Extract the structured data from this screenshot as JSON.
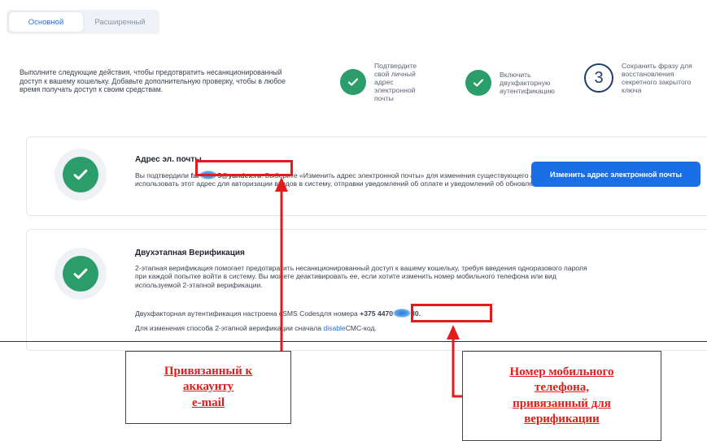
{
  "tabs": [
    {
      "label": "Основной",
      "active": true
    },
    {
      "label": "Расширенный",
      "active": false
    }
  ],
  "intro": "Выполните следующие действия, чтобы предотвратить несанкционированный доступ к вашему кошельку. Добавьте дополнительную проверку, чтобы в любое время получать доступ к своим средствам.",
  "steps": [
    {
      "label": "Подтвердите свой личный адрес электронной почты",
      "done": true
    },
    {
      "label": "Включить двухфакторную аутентификацию",
      "done": true
    },
    {
      "label": "Сохранить фразу для восстановления секретного закрытого ключа",
      "done": false,
      "number": "3"
    }
  ],
  "email_card": {
    "title": "Адрес эл. почты",
    "text_before": "Вы подтвердили ",
    "email_start": "far",
    "email_end": "5@yandex.ru",
    "text_after": ". Выберите «Изменить адрес электронной почты» для изменения существующего адреса. Мы будем использовать этот адрес для авторизации входов в систему, отправки уведомлений об оплате и уведомлений об обновлениях кошельков.",
    "button": "Изменить адрес электронной почты"
  },
  "twofa_card": {
    "title": "Двухэтапная Верификация",
    "text": "2-этапная верификация помогает предотвратить несанкционированный доступ к вашему кошельку, требуя введения одноразового пароля при каждой попытке войти в систему. Вы можете деактивировать ее, если хотите изменить номер мобильного телефона или вид используемой 2-этапной верификации.",
    "status_before": "Двухфакторная аутентификация настроена с",
    "status_method": "SMS Codes",
    "status_mid": "для номера ",
    "phone_start": "+375 4470",
    "phone_end": "30.",
    "change_before": "Для изменения способа 2-этапной верификации сначала ",
    "change_link": "disable",
    "change_after": "СМС-код."
  },
  "callouts": {
    "email": "Привязанный к\nаккаунту\ne-mail",
    "phone": "Номер мобильного\nтелефона,\nпривязанный для\nверификации"
  },
  "colors": {
    "accent_blue": "#1a6fe6",
    "success_green": "#2a9d6a",
    "annotation_red": "#e31b1b"
  }
}
